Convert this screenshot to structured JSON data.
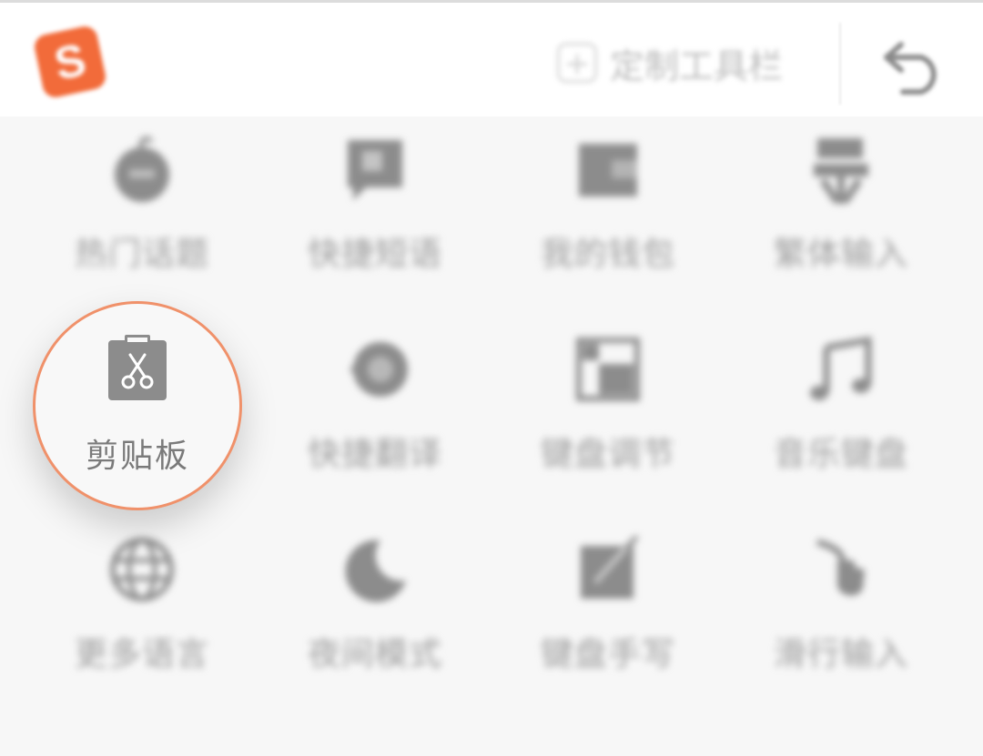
{
  "header": {
    "logo_letter": "S",
    "custom_toolbar_label": "定制工具栏",
    "custom_toolbar_icon": "plus-square-icon",
    "back_icon": "undo-icon"
  },
  "grid": {
    "items": [
      {
        "label": "热门话题",
        "icon": "hot-topic-icon"
      },
      {
        "label": "快捷短语",
        "icon": "quick-phrase-icon"
      },
      {
        "label": "我的钱包",
        "icon": "wallet-icon"
      },
      {
        "label": "繁体输入",
        "icon": "traditional-chinese-icon"
      },
      {
        "label": "",
        "icon": "clipboard-icon"
      },
      {
        "label": "快捷翻译",
        "icon": "translate-icon"
      },
      {
        "label": "键盘调节",
        "icon": "keyboard-adjust-icon"
      },
      {
        "label": "音乐键盘",
        "icon": "music-note-icon"
      },
      {
        "label": "更多语言",
        "icon": "globe-icon"
      },
      {
        "label": "夜间模式",
        "icon": "moon-icon"
      },
      {
        "label": "键盘手写",
        "icon": "handwriting-icon"
      },
      {
        "label": "滑行输入",
        "icon": "swipe-input-icon"
      }
    ]
  },
  "spotlight": {
    "label": "剪贴板",
    "icon": "clipboard-scissors-icon",
    "ring_color": "#f0916a"
  },
  "colors": {
    "brand": "#f26b3a",
    "icon_gray": "#8c8c8c",
    "background": "#f7f7f7"
  }
}
